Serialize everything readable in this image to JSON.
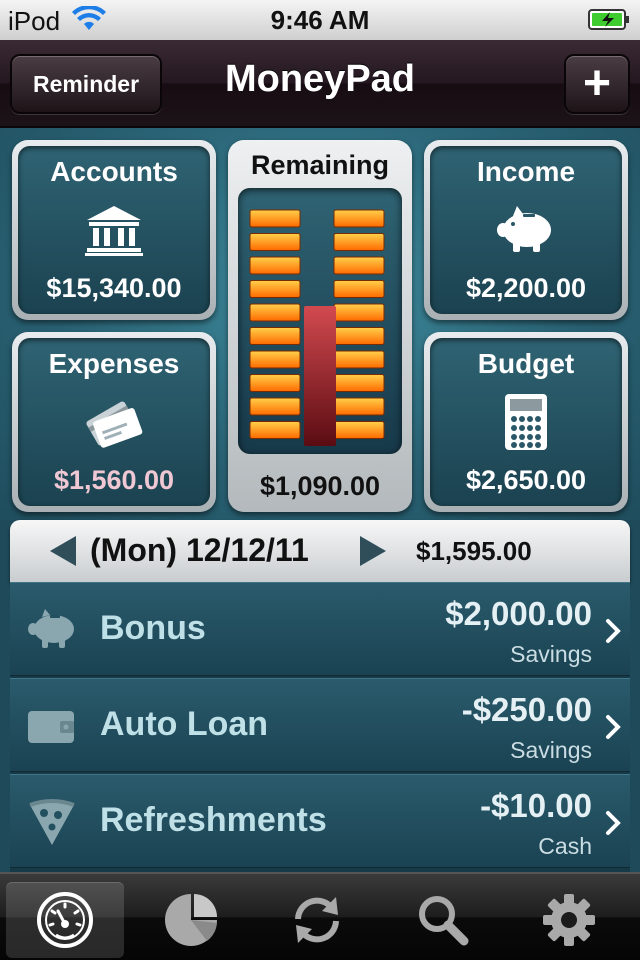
{
  "status_bar": {
    "carrier": "iPod",
    "time": "9:46 AM",
    "icons": [
      "wifi-icon",
      "battery-charging-icon"
    ]
  },
  "nav": {
    "left_button": "Reminder",
    "title": "MoneyPad",
    "right_button": "+"
  },
  "dashboard": {
    "accounts": {
      "title": "Accounts",
      "value": "$15,340.00",
      "icon": "bank-icon"
    },
    "expenses": {
      "title": "Expenses",
      "value": "$1,560.00",
      "icon": "credit-cards-icon"
    },
    "remaining": {
      "title": "Remaining",
      "value": "$1,090.00"
    },
    "income": {
      "title": "Income",
      "value": "$2,200.00",
      "icon": "piggy-bank-icon"
    },
    "budget": {
      "title": "Budget",
      "value": "$2,650.00",
      "icon": "calculator-icon"
    }
  },
  "date_bar": {
    "date": "(Mon) 12/12/11",
    "total": "$1,595.00"
  },
  "transactions": [
    {
      "name": "Bonus",
      "amount": "$2,000.00",
      "account": "Savings",
      "icon": "piggy-bank-icon"
    },
    {
      "name": "Auto Loan",
      "amount": "-$250.00",
      "account": "Savings",
      "icon": "wallet-icon"
    },
    {
      "name": "Refreshments",
      "amount": "-$10.00",
      "account": "Cash",
      "icon": "pizza-icon"
    }
  ],
  "tabs": [
    {
      "name": "dashboard",
      "icon": "speedometer-icon",
      "active": true
    },
    {
      "name": "reports",
      "icon": "pie-chart-icon",
      "active": false
    },
    {
      "name": "sync",
      "icon": "sync-icon",
      "active": false
    },
    {
      "name": "search",
      "icon": "search-icon",
      "active": false
    },
    {
      "name": "settings",
      "icon": "gear-icon",
      "active": false
    }
  ],
  "colors": {
    "background": "#1f4a5a",
    "meter_bar": "#ff8a00",
    "meter_needle": "#b8323a",
    "expense_value": "#f0c8d4"
  }
}
